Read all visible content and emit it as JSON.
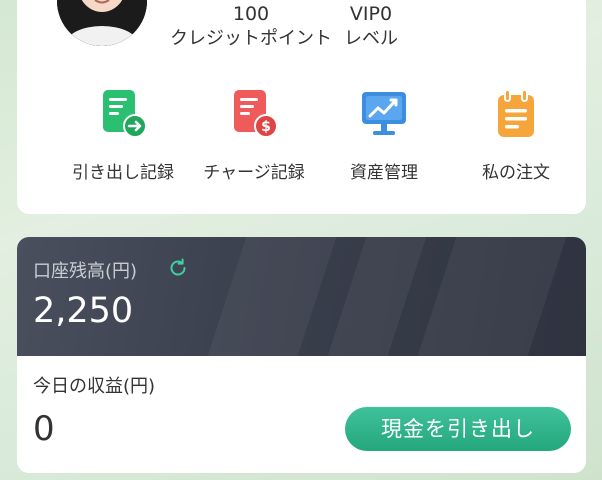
{
  "profile": {
    "credit_points": "100",
    "credit_points_label": "クレジットポイント",
    "vip_level": "VIP0",
    "vip_level_label": "レベル"
  },
  "actions": [
    {
      "label": "引き出し記録",
      "icon": "withdraw-record-icon",
      "color": "#2bbf71"
    },
    {
      "label": "チャージ記録",
      "icon": "charge-record-icon",
      "color": "#ef5a5a"
    },
    {
      "label": "資産管理",
      "icon": "asset-management-icon",
      "color": "#3d8de0"
    },
    {
      "label": "私の注文",
      "icon": "my-orders-icon",
      "color": "#f6a53a"
    }
  ],
  "balance": {
    "label": "口座残高(円)",
    "value": "2,250"
  },
  "today": {
    "label": "今日の収益(円)",
    "value": "0"
  },
  "withdraw_button": "現金を引き出し",
  "colors": {
    "accent": "#2bb58a",
    "dark_card": "#3a3f4c"
  }
}
